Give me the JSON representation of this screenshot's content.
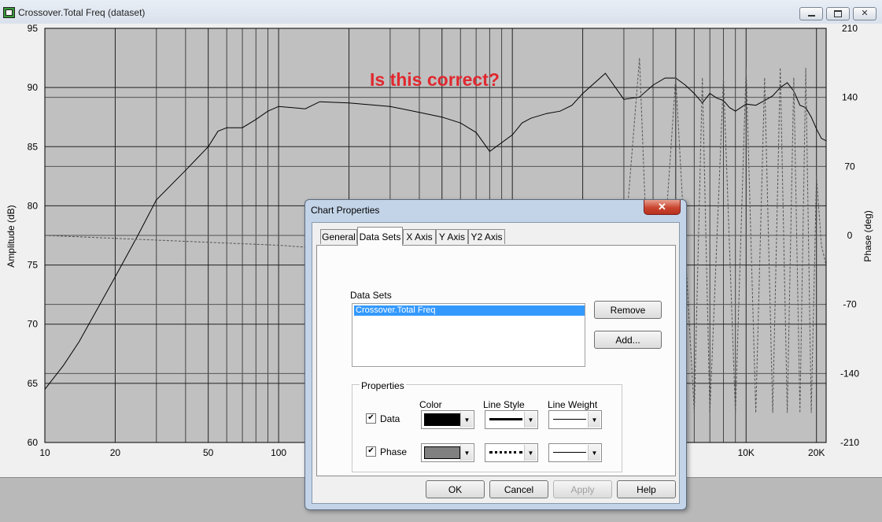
{
  "window": {
    "title": "Crossover.Total Freq (dataset)",
    "min_icon": "minimize-icon",
    "max_icon": "maximize-icon",
    "close_icon": "close-icon"
  },
  "chart": {
    "annotation": "Is this correct?",
    "ylabel_left": "Amplitude (dB)",
    "ylabel_right": "Phase (deg)",
    "x_ticks": [
      "10",
      "20",
      "50",
      "100",
      "10K",
      "20K"
    ],
    "y_ticks_left": [
      "95",
      "90",
      "85",
      "80",
      "75",
      "70",
      "65",
      "60"
    ],
    "y_ticks_right": [
      "210",
      "140",
      "70",
      "0",
      "-70",
      "-140",
      "-210"
    ]
  },
  "chart_data": {
    "type": "line",
    "x_scale": "log",
    "xlim": [
      10,
      22000
    ],
    "ylim": [
      60,
      95
    ],
    "y2lim": [
      -210,
      210
    ],
    "xlabel": "",
    "ylabel": "Amplitude (dB)",
    "y2label": "Phase (deg)",
    "grid": true,
    "series": [
      {
        "name": "Data",
        "axis": "left",
        "x": [
          10,
          12,
          14,
          17,
          20,
          25,
          30,
          40,
          50,
          55,
          60,
          70,
          80,
          90,
          100,
          130,
          150,
          200,
          300,
          400,
          500,
          600,
          700,
          800,
          1000,
          1100,
          1200,
          1400,
          1600,
          1800,
          2000,
          2500,
          3000,
          3500,
          4000,
          4500,
          5000,
          5500,
          6000,
          6500,
          7000,
          7500,
          8000,
          8500,
          9000,
          10000,
          11000,
          12000,
          13000,
          14000,
          15000,
          16000,
          17000,
          18000,
          19000,
          20000,
          21000,
          22000
        ],
        "values": [
          64.5,
          66.5,
          68.5,
          71.5,
          74,
          77.5,
          80.5,
          83,
          85,
          86.3,
          86.6,
          86.6,
          87.3,
          88,
          88.4,
          88.2,
          88.8,
          88.7,
          88.4,
          87.9,
          87.5,
          87,
          86.2,
          84.6,
          86,
          87,
          87.4,
          87.8,
          88,
          88.5,
          89.5,
          91.2,
          89,
          89.2,
          90.2,
          90.8,
          90.8,
          90.2,
          89.5,
          88.7,
          89.5,
          89.1,
          88.9,
          88.3,
          88,
          88.6,
          88.5,
          88.9,
          89.3,
          90,
          90.4,
          89.7,
          88.5,
          88.3,
          87.5,
          86.5,
          85.7,
          85.5
        ]
      },
      {
        "name": "Phase",
        "axis": "right",
        "x": [
          10,
          100,
          200,
          250,
          3000,
          3500,
          4000,
          5000,
          6000,
          6500,
          7000,
          8000,
          9000,
          10000,
          11000,
          12000,
          13000,
          14000,
          15000,
          16000,
          17000,
          18000,
          19000,
          20000,
          21000,
          22000
        ],
        "values": [
          0,
          -10,
          -15,
          -20,
          -20,
          180,
          -180,
          160,
          -180,
          160,
          -180,
          160,
          -180,
          170,
          -180,
          160,
          -180,
          170,
          -180,
          160,
          -180,
          170,
          -180,
          60,
          -10,
          -30
        ]
      }
    ]
  },
  "dialog": {
    "title": "Chart Properties",
    "close_icon": "close-icon",
    "tabs": [
      "General",
      "Data Sets",
      "X Axis",
      "Y Axis",
      "Y2 Axis"
    ],
    "active_tab": "Data Sets",
    "datasets_label": "Data Sets",
    "datasets": [
      "Crossover.Total Freq"
    ],
    "remove_label": "Remove",
    "add_label": "Add...",
    "properties_label": "Properties",
    "col_color": "Color",
    "col_line_style": "Line Style",
    "col_line_weight": "Line Weight",
    "rows": [
      {
        "label": "Data",
        "checked": true,
        "color": "#000000"
      },
      {
        "label": "Phase",
        "checked": true,
        "color": "#808080"
      }
    ],
    "check_mark": "✔",
    "ok_label": "OK",
    "cancel_label": "Cancel",
    "apply_label": "Apply",
    "help_label": "Help"
  }
}
